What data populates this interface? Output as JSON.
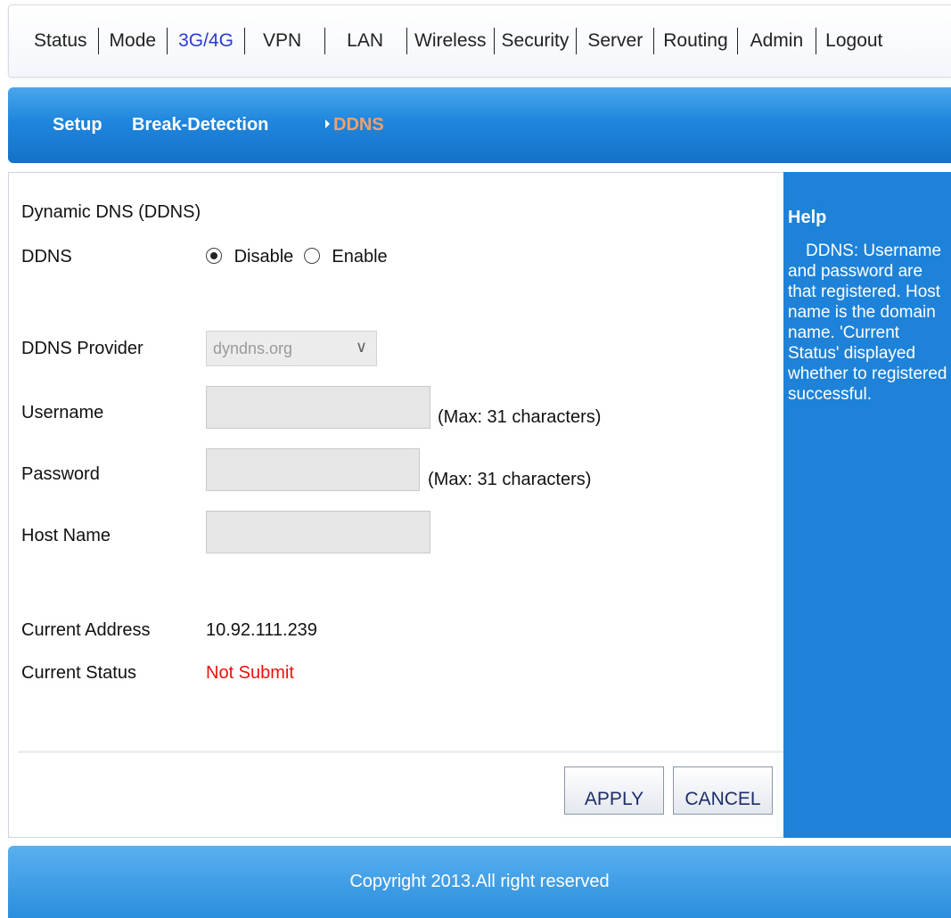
{
  "top_nav": {
    "items": [
      "Status",
      "Mode",
      "3G/4G",
      "VPN",
      "LAN",
      "Wireless",
      "Security",
      "Server",
      "Routing",
      "Admin",
      "Logout"
    ],
    "active": "3G/4G"
  },
  "sub_nav": {
    "items": [
      "Setup",
      "Break-Detection",
      "DDNS"
    ],
    "active": "DDNS"
  },
  "form": {
    "section_title": "Dynamic DNS (DDNS)",
    "ddns_label": "DDNS",
    "ddns_options": [
      "Disable",
      "Enable"
    ],
    "ddns_selected": "Disable",
    "provider_label": "DDNS Provider",
    "provider_value": "dyndns.org",
    "username_label": "Username",
    "username_value": "",
    "username_hint": "(Max: 31 characters)",
    "password_label": "Password",
    "password_value": "",
    "password_hint": "(Max: 31 characters)",
    "hostname_label": "Host Name",
    "hostname_value": "",
    "current_address_label": "Current Address",
    "current_address_value": "10.92.111.239",
    "current_status_label": "Current Status",
    "current_status_value": "Not Submit",
    "status_color": "#e8120c"
  },
  "buttons": {
    "apply": "APPLY",
    "cancel": "CANCEL"
  },
  "help": {
    "title": "Help",
    "text": "DDNS: Username and password are that registered. Host name is the domain name. 'Current Status' displayed whether to registered successful."
  },
  "footer": {
    "text": "Copyright 2013.All right reserved"
  },
  "colors": {
    "accent_blue": "#1e83d8",
    "active_nav": "#2a3bd6",
    "active_sub": "#f0a070"
  }
}
